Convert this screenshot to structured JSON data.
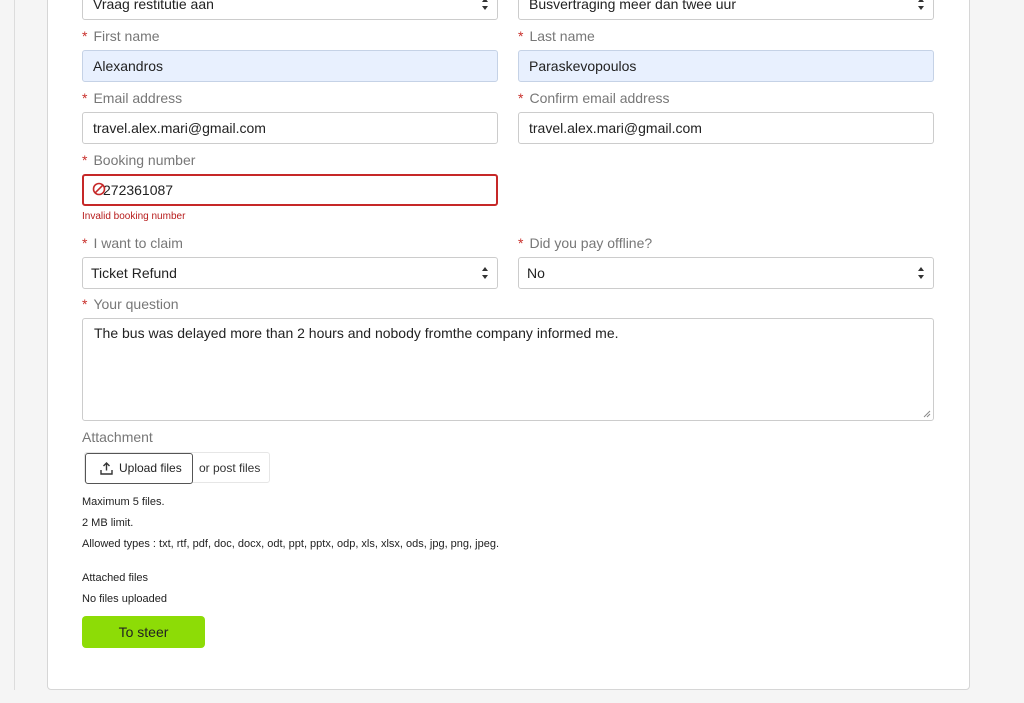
{
  "form": {
    "top_selects": {
      "left_value": "Vraag restitutie aan",
      "right_value": "Busvertraging meer dan twee uur"
    },
    "required_marker": "*",
    "first_name": {
      "label": "First name",
      "value": "Alexandros"
    },
    "last_name": {
      "label": "Last name",
      "value": "Paraskevopoulos"
    },
    "email": {
      "label": "Email address",
      "value": "travel.alex.mari@gmail.com"
    },
    "confirm_email": {
      "label": "Confirm email address",
      "value": "travel.alex.mari@gmail.com"
    },
    "booking_number": {
      "label": "Booking number",
      "value": "272361087",
      "error": "Invalid booking number"
    },
    "claim": {
      "label": "I want to claim",
      "value": "Ticket Refund"
    },
    "paid_offline": {
      "label": "Did you pay offline?",
      "value": "No"
    },
    "question": {
      "label": "Your question",
      "value": "The bus was delayed more than 2 hours and nobody fromthe company informed me."
    },
    "attachment": {
      "label": "Attachment",
      "upload_label": "Upload files",
      "post_label": "or post files",
      "max_files": "Maximum 5 files.",
      "size_limit": "2 MB limit.",
      "allowed_types": "Allowed types : txt, rtf, pdf, doc, docx, odt, ppt, pptx, odp, xls, xlsx, ods, jpg, png, jpeg.",
      "attached_label": "Attached files",
      "attached_status": "No files uploaded"
    },
    "submit_label": "To steer"
  },
  "colors": {
    "accent_submit": "#8ddc06",
    "error": "#c62828",
    "autofill_bg": "#e8f0fe"
  }
}
